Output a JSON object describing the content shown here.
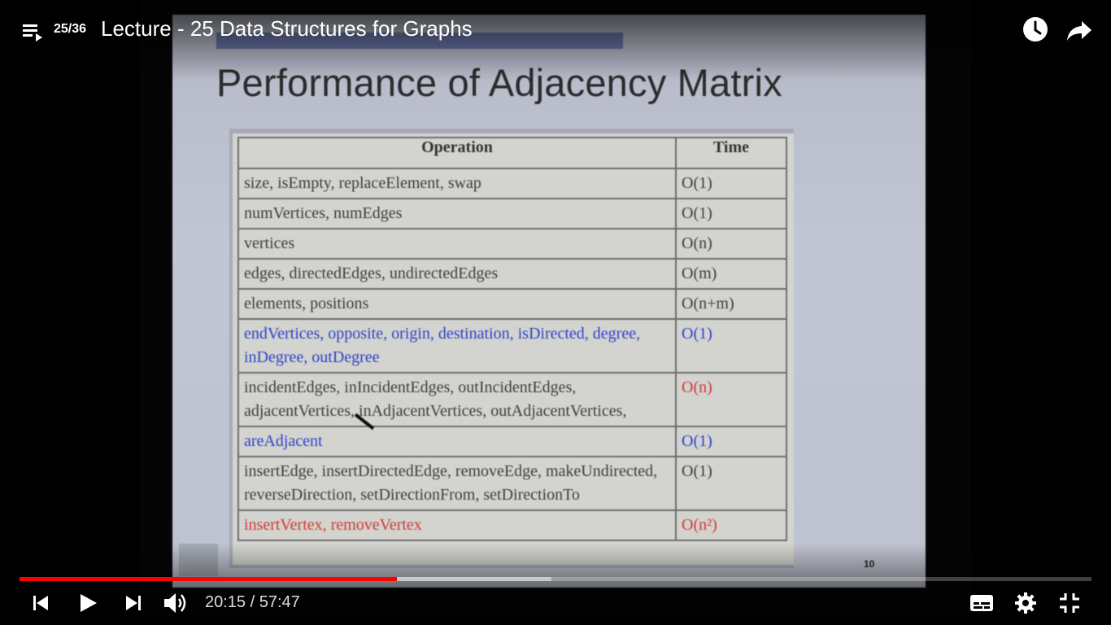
{
  "header": {
    "playlist_position": "25/36",
    "title": "Lecture - 25 Data Structures for Graphs"
  },
  "slide": {
    "title": "Performance of Adjacency Matrix",
    "table": {
      "headers": [
        "Operation",
        "Time"
      ],
      "rows": [
        {
          "operation": "size, isEmpty, replaceElement, swap",
          "time": "O(1)",
          "color": "#3e3e3e"
        },
        {
          "operation": "numVertices, numEdges",
          "time": "O(1)",
          "color": "#3e3e3e"
        },
        {
          "operation": "vertices",
          "time": "O(n)",
          "color": "#3e3e3e"
        },
        {
          "operation": "edges, directedEdges, undirectedEdges",
          "time": "O(m)",
          "color": "#3e3e3e"
        },
        {
          "operation": "elements, positions",
          "time": "O(n+m)",
          "color": "#3e3e3e"
        },
        {
          "operation": "endVertices, opposite, origin, destination, isDirected, degree, inDegree, outDegree",
          "time": "O(1)",
          "color": "#2f43c9"
        },
        {
          "operation": "incidentEdges, inIncidentEdges, outIncidentEdges, adjacentVertices, inAdjacentVertices, outAdjacentVertices,",
          "time": "O(n)",
          "color": "#3e3e3e",
          "time_color": "#d23a36"
        },
        {
          "operation": "areAdjacent",
          "time": "O(1)",
          "color": "#2f43c9"
        },
        {
          "operation": "insertEdge, insertDirectedEdge, removeEdge, makeUndirected, reverseDirection, setDirectionFrom, setDirectionTo",
          "time": "O(1)",
          "color": "#3e3e3e"
        },
        {
          "operation": "insertVertex, removeVertex",
          "time": "O(n²)",
          "color": "#d23a36"
        }
      ]
    },
    "page_number": "10"
  },
  "player": {
    "current_time": "20:15",
    "separator": " / ",
    "duration": "57:47",
    "progress_fraction": 0.352,
    "buffered_fraction": 0.496,
    "accent_color": "#ff0000"
  }
}
